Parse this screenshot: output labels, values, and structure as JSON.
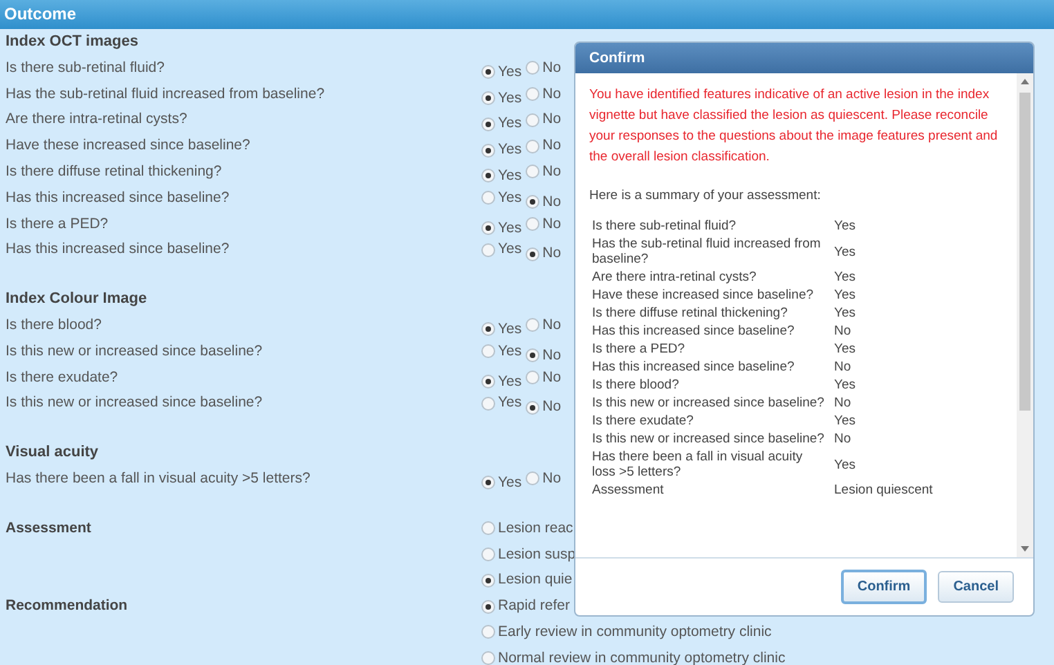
{
  "header": {
    "title": "Outcome"
  },
  "sections": [
    {
      "kind": "questions",
      "title": "Index OCT images",
      "questions": [
        {
          "text": "Is there sub-retinal fluid?",
          "options": [
            {
              "label": "Yes",
              "selected": true
            },
            {
              "label": "No",
              "selected": false
            }
          ]
        },
        {
          "text": "Has the sub-retinal fluid increased from baseline?",
          "options": [
            {
              "label": "Yes",
              "selected": true
            },
            {
              "label": "No",
              "selected": false
            }
          ]
        },
        {
          "text": "Are there intra-retinal cysts?",
          "options": [
            {
              "label": "Yes",
              "selected": true
            },
            {
              "label": "No",
              "selected": false
            }
          ]
        },
        {
          "text": "Have these increased since baseline?",
          "options": [
            {
              "label": "Yes",
              "selected": true
            },
            {
              "label": "No",
              "selected": false
            }
          ]
        },
        {
          "text": "Is there diffuse retinal thickening?",
          "options": [
            {
              "label": "Yes",
              "selected": true
            },
            {
              "label": "No",
              "selected": false
            }
          ]
        },
        {
          "text": "Has this increased since baseline?",
          "options": [
            {
              "label": "Yes",
              "selected": false
            },
            {
              "label": "No",
              "selected": true
            }
          ]
        },
        {
          "text": "Is there a PED?",
          "options": [
            {
              "label": "Yes",
              "selected": true
            },
            {
              "label": "No",
              "selected": false
            }
          ]
        },
        {
          "text": "Has this increased since baseline?",
          "options": [
            {
              "label": "Yes",
              "selected": false
            },
            {
              "label": "No",
              "selected": true
            }
          ]
        }
      ]
    },
    {
      "kind": "questions",
      "title": "Index Colour Image",
      "questions": [
        {
          "text": "Is there blood?",
          "options": [
            {
              "label": "Yes",
              "selected": true
            },
            {
              "label": "No",
              "selected": false
            }
          ]
        },
        {
          "text": "Is this new or increased since baseline?",
          "options": [
            {
              "label": "Yes",
              "selected": false
            },
            {
              "label": "No",
              "selected": true
            }
          ]
        },
        {
          "text": "Is there exudate?",
          "options": [
            {
              "label": "Yes",
              "selected": true
            },
            {
              "label": "No",
              "selected": false
            }
          ]
        },
        {
          "text": "Is this new or increased since baseline?",
          "options": [
            {
              "label": "Yes",
              "selected": false
            },
            {
              "label": "No",
              "selected": true
            }
          ]
        }
      ]
    },
    {
      "kind": "questions",
      "title": "Visual acuity",
      "questions": [
        {
          "text": "Has there been a fall in visual acuity >5 letters?",
          "options": [
            {
              "label": "Yes",
              "selected": true
            },
            {
              "label": "No",
              "selected": false
            }
          ]
        }
      ]
    },
    {
      "kind": "choice",
      "title": "Assessment",
      "options": [
        {
          "label": "Lesion reac",
          "selected": false
        },
        {
          "label": "Lesion susp",
          "selected": false
        },
        {
          "label": "Lesion quie",
          "selected": true
        }
      ]
    },
    {
      "kind": "choice",
      "title": "Recommendation",
      "options": [
        {
          "label": "Rapid refer",
          "selected": true
        },
        {
          "label": "Early review in community optometry clinic",
          "selected": false
        },
        {
          "label": "Normal review in community optometry clinic",
          "selected": false
        }
      ]
    }
  ],
  "dialog": {
    "title": "Confirm",
    "warning": "You have identified features indicative of an active lesion in the index vignette but have classified the lesion as quiescent. Please reconcile your responses to the questions about the image features present and the overall lesion classification.",
    "summary_intro": "Here is a summary of your assessment:",
    "summary": [
      {
        "question": "Is there sub-retinal fluid?",
        "answer": "Yes"
      },
      {
        "question": "Has the sub-retinal fluid increased from baseline?",
        "answer": "Yes"
      },
      {
        "question": "Are there intra-retinal cysts?",
        "answer": "Yes"
      },
      {
        "question": "Have these increased since baseline?",
        "answer": "Yes"
      },
      {
        "question": "Is there diffuse retinal thickening?",
        "answer": "Yes"
      },
      {
        "question": "Has this increased since baseline?",
        "answer": "No"
      },
      {
        "question": "Is there a PED?",
        "answer": "Yes"
      },
      {
        "question": "Has this increased since baseline?",
        "answer": "No"
      },
      {
        "question": "Is there blood?",
        "answer": "Yes"
      },
      {
        "question": "Is this new or increased since baseline?",
        "answer": "No"
      },
      {
        "question": "Is there exudate?",
        "answer": "Yes"
      },
      {
        "question": "Is this new or increased since baseline?",
        "answer": "No"
      },
      {
        "question": "Has there been a fall in visual acuity loss >5 letters?",
        "answer": "Yes"
      },
      {
        "question": "Assessment",
        "answer": "Lesion quiescent"
      }
    ],
    "buttons": [
      {
        "label": "Confirm",
        "focused": true
      },
      {
        "label": "Cancel",
        "focused": false
      }
    ]
  }
}
